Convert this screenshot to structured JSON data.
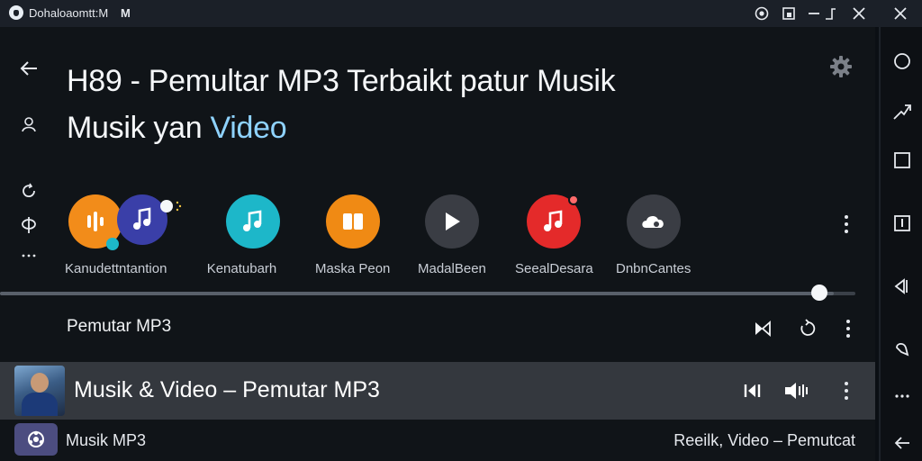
{
  "window": {
    "title": "Dohaloaomtt:M",
    "title_extra": "M",
    "icons": [
      "shield-icon",
      "smiley-icon",
      "picture-in-picture-icon",
      "minimize-icon",
      "maximize-icon",
      "close-icon"
    ]
  },
  "header": {
    "title_part1": "H89 - Pemultar MP3 Terbaikt patur Musik",
    "title_part2": "Musik yan ",
    "title_accent": "Video"
  },
  "apps": [
    {
      "label": "Kanudettntantion",
      "icon": "music-note-pair-icon",
      "color": "#f28c1a"
    },
    {
      "label": "Kenatubarh",
      "icon": "music-note-icon",
      "color": "#1db7c9"
    },
    {
      "label": "Maska Peon",
      "icon": "book-icon",
      "color": "#f08a14"
    },
    {
      "label": "MadalBeen",
      "icon": "play-icon",
      "color": "#3a3d44"
    },
    {
      "label": "SeealDesara",
      "icon": "music-note-icon",
      "color": "#e42a2a"
    },
    {
      "label": "DnbnCantes",
      "icon": "cloud-icon",
      "color": "#3a3d44"
    }
  ],
  "playback": {
    "progress": 0.975
  },
  "section": {
    "title": "Pemutar MP3"
  },
  "now_playing": {
    "title": "Musik & Video – Pemutar MP3"
  },
  "bottom": {
    "left_text": "Musik MP3",
    "right_text": "Reeilk, Video – Pemutcat"
  },
  "colors": {
    "accent": "#8fd3ff",
    "background": "#101418",
    "highlight_row": "#34383e"
  }
}
